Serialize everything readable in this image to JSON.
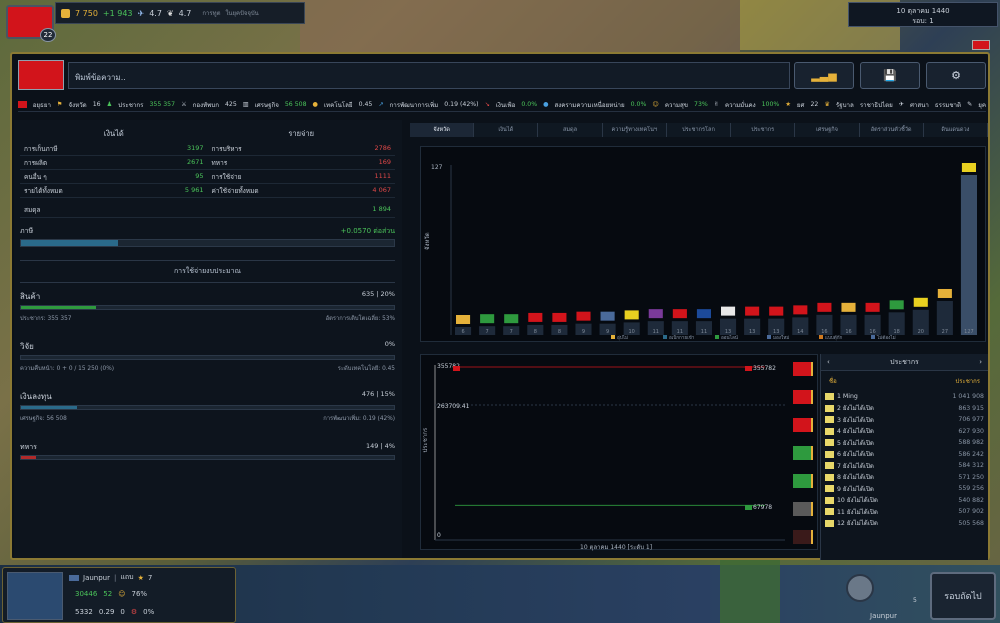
{
  "top": {
    "gold": "7 750",
    "income": "+1 943",
    "stat2": "4.7",
    "stat3": "4.7",
    "tab1": "การทูต",
    "tab2": "ในยุคปัจจุบัน",
    "notifications": "22",
    "date": "10 ตุลาคม 1440",
    "turn": "รอบ: 1"
  },
  "header": {
    "message_placeholder": "พิมพ์ข้อความ.."
  },
  "stats": {
    "country": "อยุธยา",
    "soldiers_label": "จังหวัด",
    "soldiers": "16",
    "population_label": "ประชากร",
    "population": "355 357",
    "army_label": "กองทัพบก",
    "army": "425",
    "economy_label": "เศรษฐกิจ",
    "economy": "56 508",
    "tech_label": "เทคโนโลยี",
    "tech": "0.45",
    "growth_label": "การพัฒนาการเพิ่ม",
    "growth": "0.19 (42%)",
    "inflation_label": "เงินเฟ้อ",
    "inflation": "0.0%",
    "war_label": "สงครามความเหนื่อยหน่าย",
    "war": "0.0%",
    "happiness_label": "ความสุข",
    "happiness": "73%",
    "stability_label": "ความมั่นคง",
    "stability": "100%",
    "rank_label": "ยศ",
    "rank": "22",
    "gov_label": "รัฐบาล",
    "gov": "ราชาธิปไตย",
    "religion_label": "ศาสนา",
    "religion": "ธรรมชาติ",
    "extra": "ยุค"
  },
  "finance": {
    "income_title": "เงินได้",
    "expense_title": "รายจ่าย",
    "rows": [
      {
        "l1": "การเก็บภาษี",
        "v1": "3197",
        "l2": "การบริหาร",
        "v2": "2786"
      },
      {
        "l1": "การผลิต",
        "v1": "2671",
        "l2": "ทหาร",
        "v2": "169"
      },
      {
        "l1": "คนอื่น ๆ",
        "v1": "95",
        "l2": "การใช้จ่าย",
        "v2": "1111"
      },
      {
        "l1": "รายได้ทั้งหมด",
        "v1": "5 961",
        "l2": "ค่าใช้จ่ายทั้งหมด",
        "v2": "4 067"
      }
    ],
    "balance_label": "สมดุล",
    "balance": "1 894",
    "tax_label": "ภาษี",
    "tax_value": "+0.0570 ต่อส่วน"
  },
  "spending": {
    "title": "การใช้จ่ายงบประมาณ",
    "goods_label": "สินค้า",
    "goods_value": "635 | 20%",
    "goods_sub_l": "ประชากร: 355 357",
    "goods_sub_r": "อัตราการเติบโตเฉลี่ย: 53%",
    "research_label": "วิจัย",
    "research_value": "0%",
    "research_sub_l": "ความคืบหน้า: 0 + 0 / 15 250 (0%)",
    "research_sub_r": "ระดับเทคโนโลยี: 0.45",
    "invest_label": "เงินลงทุน",
    "invest_value": "476 | 15%",
    "invest_sub_l": "เศรษฐกิจ: 56 508",
    "invest_sub_r": "การพัฒนาเพิ่ม: 0.19 (42%)",
    "military_label": "ทหาร",
    "military_value": "149 | 4%"
  },
  "tabs": [
    "จังหวัด",
    "เงินได้",
    "สมดุล",
    "ความรู้ทางเทคโนฯ",
    "ประชากรโลก",
    "ประชากร",
    "เศรษฐกิจ",
    "อัตราส่วนตัวชี้วัด",
    "ดินแดนดวง"
  ],
  "chart_data": [
    {
      "type": "bar",
      "ylabel": "จังหวัด",
      "ymax": 127,
      "ytick": "127",
      "values": [
        6,
        7,
        7,
        8,
        8,
        9,
        9,
        10,
        11,
        11,
        11,
        13,
        13,
        13,
        14,
        16,
        16,
        16,
        18,
        20,
        27,
        127
      ],
      "legend": [
        "อุ่ปไม่",
        "อเบิกกายเข้า",
        "ออนไลน์",
        "มองใหม่",
        "แบบตุ้กัก",
        "ไม่ต้องไม่"
      ]
    },
    {
      "type": "line",
      "ylabel": "ประชากร",
      "xlabel": "10 ตุลาคม 1440 [ระดับ 1]",
      "top_label": "355782",
      "mid_label": "263709.41",
      "bottom_label": "0",
      "right_top": "355782",
      "right_bottom": "67978",
      "series": [
        {
          "values": [
            355782,
            355782
          ]
        },
        {
          "values": [
            67978,
            67978
          ]
        }
      ]
    }
  ],
  "ranking": {
    "title": "ประชากร",
    "col_name": "ชื่อ",
    "col_value": "ประชากร",
    "rows": [
      {
        "n": "1 Ming",
        "v": "1 041 908"
      },
      {
        "n": "2 ยังไม่ได้เปิด",
        "v": "863 915"
      },
      {
        "n": "3 ยังไม่ได้เปิด",
        "v": "706 977"
      },
      {
        "n": "4 ยังไม่ได้เปิด",
        "v": "627 930"
      },
      {
        "n": "5 ยังไม่ได้เปิด",
        "v": "588 982"
      },
      {
        "n": "6 ยังไม่ได้เปิด",
        "v": "586 242"
      },
      {
        "n": "7 ยังไม่ได้เปิด",
        "v": "584 312"
      },
      {
        "n": "8 ยังไม่ได้เปิด",
        "v": "571 250"
      },
      {
        "n": "9 ยังไม่ได้เปิด",
        "v": "559 256"
      },
      {
        "n": "10 ยังไม่ได้เปิด",
        "v": "540 882"
      },
      {
        "n": "11 ยังไม่ได้เปิด",
        "v": "507 902"
      },
      {
        "n": "12 ยังไม่ได้เปิด",
        "v": "505 568"
      }
    ]
  },
  "bottom": {
    "province": "Jaunpur",
    "region": "แถบ",
    "rank": "7",
    "pop": "30446",
    "v2": "52",
    "pct": "76%",
    "money": "5332",
    "v3": "0.29",
    "v4": "0",
    "pct2": "0%",
    "selected": "Jaunpur",
    "count": "5",
    "endturn": "รอบถัดไป"
  },
  "colors": {
    "accent": "#8b7a34",
    "red_flag": "#d2141b",
    "green": "#4bc45a"
  }
}
